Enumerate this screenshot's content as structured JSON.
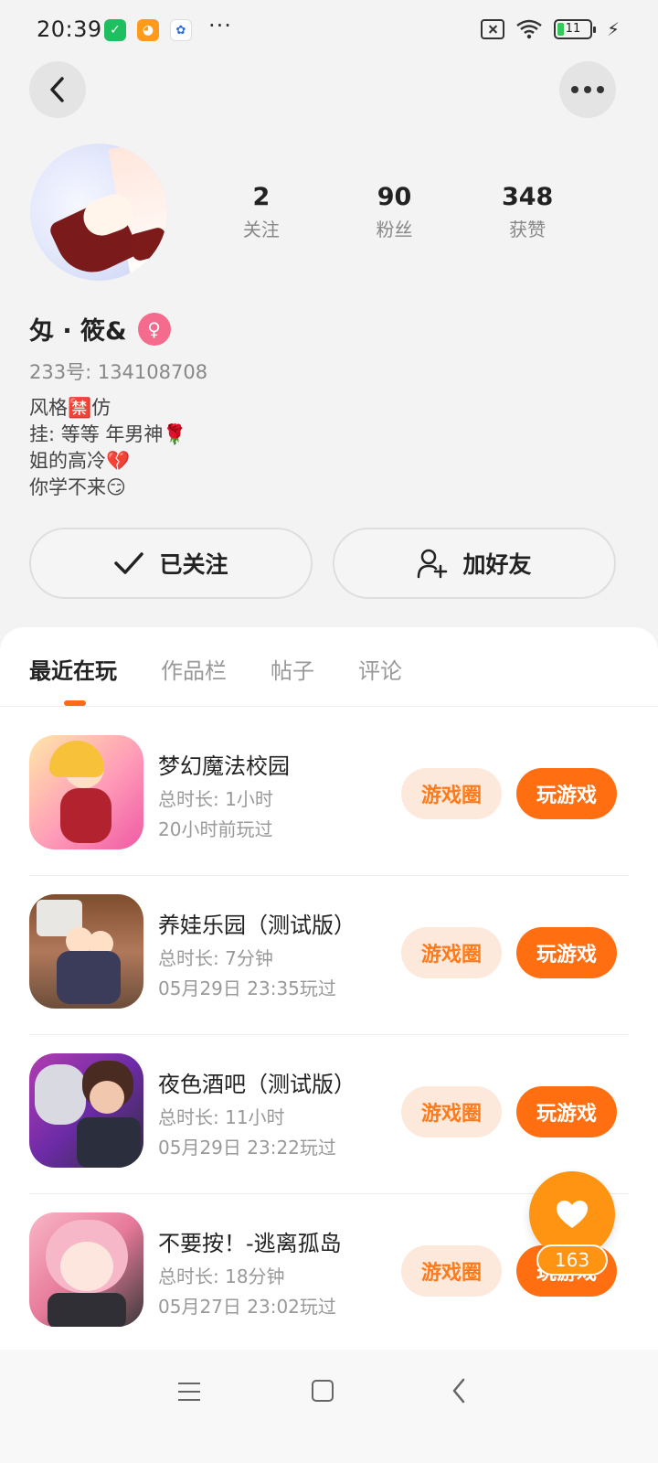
{
  "status_bar": {
    "time": "20:39",
    "dots": "···",
    "battery_level": "11",
    "icons": [
      "shield-app-icon",
      "cat-app-icon",
      "baidu-app-icon",
      "no-sim-icon",
      "wifi-icon",
      "battery-icon",
      "charging-bolt-icon"
    ]
  },
  "header": {
    "back_icon": "chevron-left-icon",
    "more_icon": "more-horizontal-icon"
  },
  "profile": {
    "nickname": "匁 · 筱&",
    "gender_symbol": "♀",
    "user_id": "233号: 134108708",
    "bio_lines": [
      "风格🈲仿",
      "挂: 等等 年男神🌹",
      "姐的高冷💔",
      "你学不来😏"
    ],
    "stats": [
      {
        "value": "2",
        "label": "关注"
      },
      {
        "value": "90",
        "label": "粉丝"
      },
      {
        "value": "348",
        "label": "获赞"
      }
    ]
  },
  "actions": {
    "follow_label": "已关注",
    "add_friend_label": "加好友"
  },
  "tabs": [
    {
      "label": "最近在玩",
      "active": true
    },
    {
      "label": "作品栏",
      "active": false
    },
    {
      "label": "帖子",
      "active": false
    },
    {
      "label": "评论",
      "active": false
    }
  ],
  "games": [
    {
      "title": "梦幻魔法校园",
      "duration": "总时长: 1小时",
      "last_played": "20小时前玩过",
      "circle_label": "游戏圈",
      "play_label": "玩游戏"
    },
    {
      "title": "养娃乐园（测试版）",
      "duration": "总时长: 7分钟",
      "last_played": "05月29日 23:35玩过",
      "circle_label": "游戏圈",
      "play_label": "玩游戏"
    },
    {
      "title": "夜色酒吧（测试版）",
      "duration": "总时长: 11小时",
      "last_played": "05月29日 23:22玩过",
      "circle_label": "游戏圈",
      "play_label": "玩游戏"
    },
    {
      "title": "不要按！-逃离孤岛",
      "duration": "总时长: 18分钟",
      "last_played": "05月27日 23:02玩过",
      "circle_label": "游戏圈",
      "play_label": "玩游戏"
    }
  ],
  "like_fab": {
    "count": "163"
  },
  "colors": {
    "accent_orange": "#ff6f12",
    "light_orange": "#fde9dc",
    "fab_orange": "#ff9413",
    "gender_pink": "#f46b8d"
  }
}
